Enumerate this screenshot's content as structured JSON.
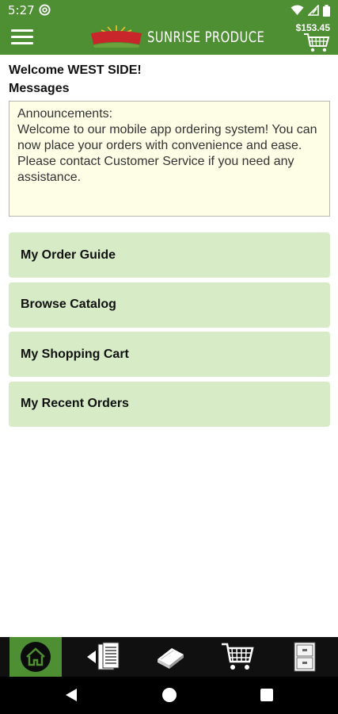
{
  "status": {
    "time": "5:27",
    "icons": [
      "at-sign-icon",
      "wifi-icon",
      "signal-icon",
      "battery-icon"
    ]
  },
  "appbar": {
    "menu_icon": "hamburger-icon",
    "brand": "SUNRISE PRODUCE",
    "logo_script": "Sunrise Produce",
    "cart_total": "$153.45",
    "cart_icon": "cart-icon"
  },
  "content": {
    "welcome": "Welcome WEST SIDE!",
    "messages_heading": "Messages",
    "announcement_title": "Announcements:",
    "announcement_body": "Welcome to our mobile app ordering system! You can now place your orders with convenience and ease. Please contact Customer Service if you need any assistance."
  },
  "menu": [
    {
      "label": "My Order Guide"
    },
    {
      "label": "Browse Catalog"
    },
    {
      "label": "My Shopping Cart"
    },
    {
      "label": "My Recent Orders"
    }
  ],
  "tabs": [
    {
      "icon": "home-icon",
      "active": true
    },
    {
      "icon": "order-guide-icon",
      "active": false
    },
    {
      "icon": "catalog-book-icon",
      "active": false
    },
    {
      "icon": "shopping-cart-icon",
      "active": false
    },
    {
      "icon": "file-cabinet-icon",
      "active": false
    }
  ],
  "colors": {
    "brand_green": "#4e8f34",
    "menu_button_bg": "#d7ecc6",
    "message_bg": "#fefee6"
  }
}
